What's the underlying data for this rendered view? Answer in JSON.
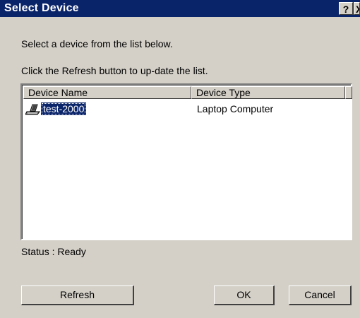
{
  "window": {
    "title": "Select Device",
    "help_label": "?",
    "close_label": "X"
  },
  "instructions": {
    "line1": "Select a device from the list below.",
    "line2": "Click the Refresh button to up-date the list."
  },
  "device_list": {
    "columns": [
      "Device Name",
      "Device Type"
    ],
    "rows": [
      {
        "name": "test-2000",
        "type": "Laptop Computer",
        "icon": "laptop-icon",
        "selected": true
      }
    ]
  },
  "status": {
    "text": "Status : Ready"
  },
  "buttons": {
    "refresh": "Refresh",
    "ok": "OK",
    "cancel": "Cancel"
  },
  "colors": {
    "titlebar": "#0a246a",
    "face": "#d4d0c8",
    "selection": "#0a246a"
  }
}
